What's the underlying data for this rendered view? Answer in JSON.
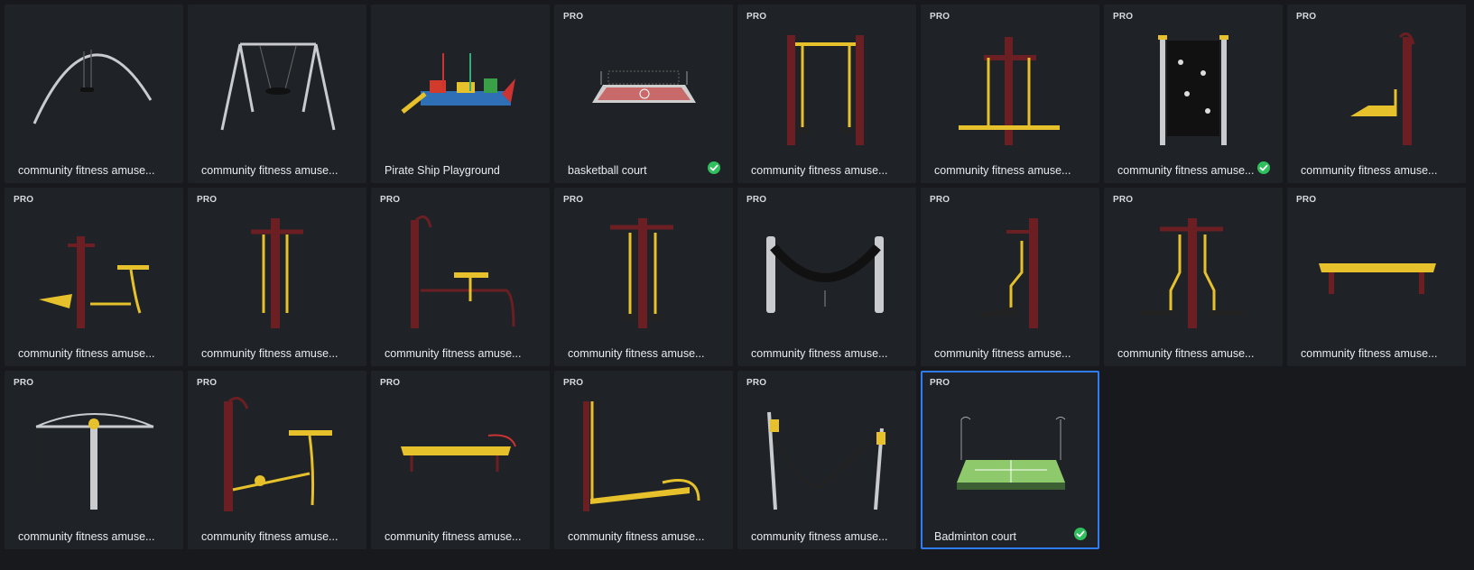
{
  "colors": {
    "background": "#17191d",
    "card": "#1f2227",
    "selected_border": "#2f7cf6",
    "check": "#2fbf5c",
    "maroon": "#6b1f22",
    "yellow": "#e6c12b",
    "silver": "#c9cbce"
  },
  "assets": [
    {
      "label": "community fitness amuse...",
      "pro": false,
      "badge": "",
      "done": false,
      "selected": false,
      "art": "arc-swing"
    },
    {
      "label": "community fitness amuse...",
      "pro": false,
      "badge": "",
      "done": false,
      "selected": false,
      "art": "a-frame-swing"
    },
    {
      "label": "Pirate Ship Playground",
      "pro": false,
      "badge": "",
      "done": false,
      "selected": false,
      "art": "pirate-ship"
    },
    {
      "label": "basketball court",
      "pro": true,
      "badge": "PRO",
      "done": true,
      "selected": false,
      "art": "basketball-court"
    },
    {
      "label": "community fitness amuse...",
      "pro": true,
      "badge": "PRO",
      "done": false,
      "selected": false,
      "art": "two-post-frame"
    },
    {
      "label": "community fitness amuse...",
      "pro": true,
      "badge": "PRO",
      "done": false,
      "selected": false,
      "art": "double-walker"
    },
    {
      "label": "community fitness amuse...",
      "pro": true,
      "badge": "PRO",
      "done": true,
      "selected": false,
      "art": "climbing-wall"
    },
    {
      "label": "community fitness amuse...",
      "pro": true,
      "badge": "PRO",
      "done": false,
      "selected": false,
      "art": "single-post-pedal"
    },
    {
      "label": "community fitness amuse...",
      "pro": true,
      "badge": "PRO",
      "done": false,
      "selected": false,
      "art": "rider"
    },
    {
      "label": "community fitness amuse...",
      "pro": true,
      "badge": "PRO",
      "done": false,
      "selected": false,
      "art": "single-walker"
    },
    {
      "label": "community fitness amuse...",
      "pro": true,
      "badge": "PRO",
      "done": false,
      "selected": false,
      "art": "seated-pull"
    },
    {
      "label": "community fitness amuse...",
      "pro": true,
      "badge": "PRO",
      "done": false,
      "selected": false,
      "art": "stepper"
    },
    {
      "label": "community fitness amuse...",
      "pro": true,
      "badge": "PRO",
      "done": false,
      "selected": false,
      "art": "hammock-swing"
    },
    {
      "label": "community fitness amuse...",
      "pro": true,
      "badge": "PRO",
      "done": false,
      "selected": false,
      "art": "single-post-step"
    },
    {
      "label": "community fitness amuse...",
      "pro": true,
      "badge": "PRO",
      "done": false,
      "selected": false,
      "art": "twin-step"
    },
    {
      "label": "community fitness amuse...",
      "pro": true,
      "badge": "PRO",
      "done": false,
      "selected": false,
      "art": "bench"
    },
    {
      "label": "community fitness amuse...",
      "pro": true,
      "badge": "PRO",
      "done": false,
      "selected": false,
      "art": "pull-down"
    },
    {
      "label": "community fitness amuse...",
      "pro": true,
      "badge": "PRO",
      "done": false,
      "selected": false,
      "art": "bike"
    },
    {
      "label": "community fitness amuse...",
      "pro": true,
      "badge": "PRO",
      "done": false,
      "selected": false,
      "art": "sit-up-board"
    },
    {
      "label": "community fitness amuse...",
      "pro": true,
      "badge": "PRO",
      "done": false,
      "selected": false,
      "art": "rower"
    },
    {
      "label": "community fitness amuse...",
      "pro": true,
      "badge": "PRO",
      "done": false,
      "selected": false,
      "art": "leg-swing"
    },
    {
      "label": "Badminton court",
      "pro": true,
      "badge": "PRO",
      "done": true,
      "selected": true,
      "art": "badminton-court"
    }
  ]
}
